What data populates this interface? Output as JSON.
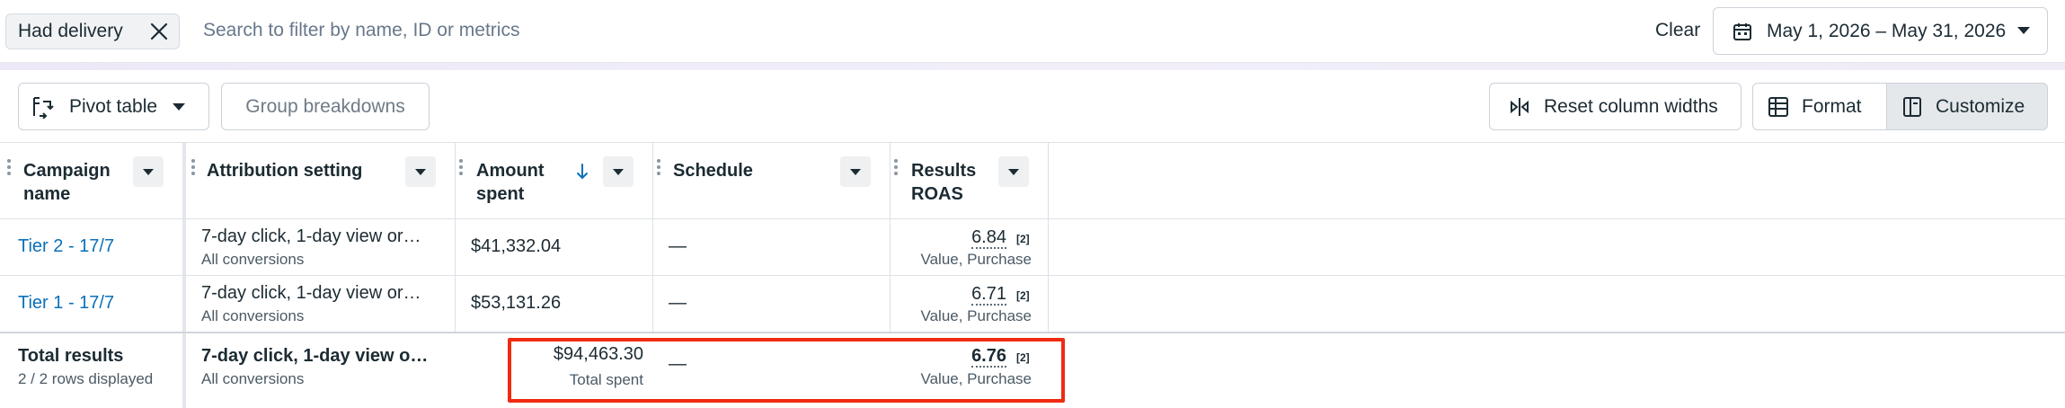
{
  "filters": {
    "chip_label": "Had delivery",
    "search_placeholder": "Search to filter by name, ID or metrics",
    "clear_label": "Clear",
    "date_range": "May 1, 2026 – May 31, 2026"
  },
  "toolbar": {
    "pivot_label": "Pivot table",
    "group_label": "Group breakdowns",
    "reset_label": "Reset column widths",
    "format_label": "Format",
    "customize_label": "Customize"
  },
  "columns": {
    "campaign": [
      "Campaign",
      "name"
    ],
    "attribution": "Attribution setting",
    "amount": [
      "Amount",
      "spent"
    ],
    "schedule": "Schedule",
    "roas": [
      "Results",
      "ROAS"
    ]
  },
  "rows": [
    {
      "campaign": "Tier 2 - 17/7",
      "attribution": "7-day click, 1-day view or…",
      "attribution_sub": "All conversions",
      "amount": "$41,332.04",
      "schedule": "—",
      "roas": "6.84",
      "roas_ref": "[2]",
      "roas_sub": "Value, Purchase"
    },
    {
      "campaign": "Tier 1 - 17/7",
      "attribution": "7-day click, 1-day view or…",
      "attribution_sub": "All conversions",
      "amount": "$53,131.26",
      "schedule": "—",
      "roas": "6.71",
      "roas_ref": "[2]",
      "roas_sub": "Value, Purchase"
    }
  ],
  "totals": {
    "label": "Total results",
    "sub": "2 / 2 rows displayed",
    "attribution": "7-day click, 1-day view o…",
    "attribution_sub": "All conversions",
    "amount": "$94,463.30",
    "amount_sub": "Total spent",
    "schedule": "—",
    "roas": "6.76",
    "roas_ref": "[2]",
    "roas_sub": "Value, Purchase"
  },
  "colors": {
    "link": "#0a70b9",
    "highlight": "#ef2b12",
    "text": "#1c2b33"
  },
  "icons": [
    "close-icon",
    "calendar-icon",
    "chevron-down-icon",
    "pivot-table-icon",
    "reset-columns-icon",
    "format-icon",
    "customize-icon",
    "sort-down-icon",
    "drag-handle-icon"
  ]
}
